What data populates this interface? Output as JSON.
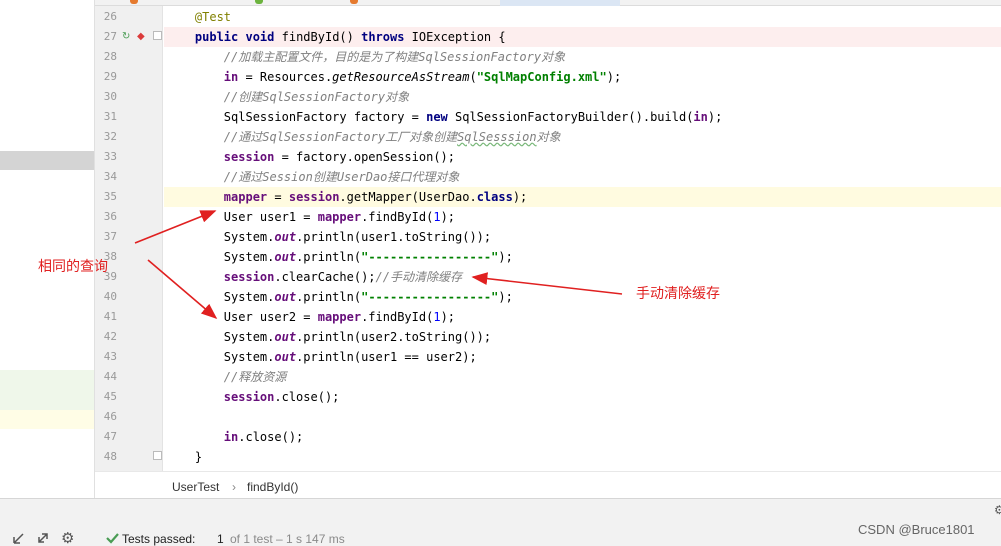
{
  "editor": {
    "lines": [
      {
        "num": "26",
        "segments": [
          {
            "t": "    "
          },
          {
            "t": "@Test",
            "c": "ann"
          }
        ]
      },
      {
        "num": "27",
        "segments": [
          {
            "t": "    "
          },
          {
            "t": "public void",
            "c": "kw"
          },
          {
            "t": " findById() "
          },
          {
            "t": "throws",
            "c": "kw"
          },
          {
            "t": " IOException {"
          }
        ]
      },
      {
        "num": "28",
        "segments": [
          {
            "t": "        "
          },
          {
            "t": "//加载主配置文件，目的是为了构建SqlSessionFactory对象",
            "c": "cm"
          }
        ]
      },
      {
        "num": "29",
        "segments": [
          {
            "t": "        "
          },
          {
            "t": "in",
            "c": "fld"
          },
          {
            "t": " = Resources."
          },
          {
            "t": "getResourceAsStream",
            "c": "smeth"
          },
          {
            "t": "("
          },
          {
            "t": "\"SqlMapConfig.xml\"",
            "c": "str"
          },
          {
            "t": ");"
          }
        ]
      },
      {
        "num": "30",
        "segments": [
          {
            "t": "        "
          },
          {
            "t": "//创建SqlSessionFactory对象",
            "c": "cm"
          }
        ]
      },
      {
        "num": "31",
        "segments": [
          {
            "t": "        SqlSessionFactory factory = "
          },
          {
            "t": "new",
            "c": "kw"
          },
          {
            "t": " SqlSessionFactoryBuilder().build("
          },
          {
            "t": "in",
            "c": "fld"
          },
          {
            "t": ");"
          }
        ]
      },
      {
        "num": "32",
        "segments": [
          {
            "t": "        "
          },
          {
            "t": "//通过SqlSessionFactory工厂对象创建",
            "c": "cm"
          },
          {
            "t": "SqlSesssion",
            "c": "cm typo"
          },
          {
            "t": "对象",
            "c": "cm"
          }
        ]
      },
      {
        "num": "33",
        "segments": [
          {
            "t": "        "
          },
          {
            "t": "session",
            "c": "fld"
          },
          {
            "t": " = factory.openSession();"
          }
        ]
      },
      {
        "num": "34",
        "segments": [
          {
            "t": "        "
          },
          {
            "t": "//通过Session创建UserDao接口代理对象",
            "c": "cm"
          }
        ]
      },
      {
        "num": "35",
        "segments": [
          {
            "t": "        "
          },
          {
            "t": "mapper",
            "c": "fld"
          },
          {
            "t": " = "
          },
          {
            "t": "session",
            "c": "fld"
          },
          {
            "t": ".getMapper(UserDao."
          },
          {
            "t": "class",
            "c": "kw"
          },
          {
            "t": ");"
          }
        ]
      },
      {
        "num": "36",
        "segments": [
          {
            "t": "        User user1 = "
          },
          {
            "t": "mapper",
            "c": "fld"
          },
          {
            "t": ".findById("
          },
          {
            "t": "1",
            "c": "num"
          },
          {
            "t": ");"
          }
        ]
      },
      {
        "num": "37",
        "segments": [
          {
            "t": "        System."
          },
          {
            "t": "out",
            "c": "sfld"
          },
          {
            "t": ".println(user1.toString());"
          }
        ]
      },
      {
        "num": "38",
        "segments": [
          {
            "t": "        System."
          },
          {
            "t": "out",
            "c": "sfld"
          },
          {
            "t": ".println("
          },
          {
            "t": "\"-----------------\"",
            "c": "str"
          },
          {
            "t": ");"
          }
        ]
      },
      {
        "num": "39",
        "segments": [
          {
            "t": "        "
          },
          {
            "t": "session",
            "c": "fld"
          },
          {
            "t": ".clearCache();"
          },
          {
            "t": "//手动清除缓存",
            "c": "cm"
          }
        ]
      },
      {
        "num": "40",
        "segments": [
          {
            "t": "        System."
          },
          {
            "t": "out",
            "c": "sfld"
          },
          {
            "t": ".println("
          },
          {
            "t": "\"-----------------\"",
            "c": "str"
          },
          {
            "t": ");"
          }
        ]
      },
      {
        "num": "41",
        "segments": [
          {
            "t": "        User user2 = "
          },
          {
            "t": "mapper",
            "c": "fld"
          },
          {
            "t": ".findById("
          },
          {
            "t": "1",
            "c": "num"
          },
          {
            "t": ");"
          }
        ]
      },
      {
        "num": "42",
        "segments": [
          {
            "t": "        System."
          },
          {
            "t": "out",
            "c": "sfld"
          },
          {
            "t": ".println(user2.toString());"
          }
        ]
      },
      {
        "num": "43",
        "segments": [
          {
            "t": "        System."
          },
          {
            "t": "out",
            "c": "sfld"
          },
          {
            "t": ".println(user1 == user2);"
          }
        ]
      },
      {
        "num": "44",
        "segments": [
          {
            "t": "        "
          },
          {
            "t": "//释放资源",
            "c": "cm"
          }
        ]
      },
      {
        "num": "45",
        "segments": [
          {
            "t": "        "
          },
          {
            "t": "session",
            "c": "fld"
          },
          {
            "t": ".close();"
          }
        ]
      },
      {
        "num": "46",
        "segments": []
      },
      {
        "num": "47",
        "segments": [
          {
            "t": "        "
          },
          {
            "t": "in",
            "c": "fld"
          },
          {
            "t": ".close();"
          }
        ]
      },
      {
        "num": "48",
        "segments": [
          {
            "t": "    }"
          }
        ]
      }
    ],
    "highlighted_line": "27",
    "current_line": "35"
  },
  "breadcrumb": {
    "class_name": "UserTest",
    "separator": "›",
    "method_name": "findById()"
  },
  "status": {
    "check_icon": "check-icon",
    "prefix": "Tests passed:",
    "passed_count": "1",
    "detail": "of 1 test – 1 s 147 ms"
  },
  "annotations": {
    "same_query": "相同的查询",
    "clear_cache": "手动清除缓存"
  },
  "watermark": "CSDN @Bruce1801",
  "colors": {
    "annotation": "#e02020",
    "highlight_line": "#fdeeee",
    "current_line": "#fffbe0",
    "keyword": "#000080",
    "string": "#008000",
    "comment": "#808080",
    "field": "#660e7a"
  }
}
